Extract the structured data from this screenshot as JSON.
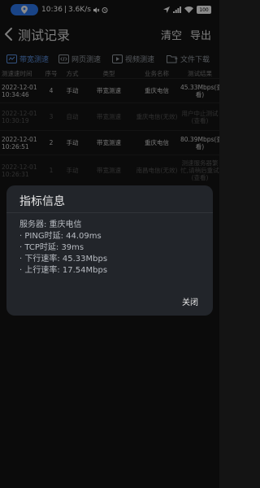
{
  "status_bar": {
    "time": "10:36",
    "speed": "3.6K/s",
    "battery": "100"
  },
  "header": {
    "title": "测试记录",
    "clear_label": "清空",
    "export_label": "导出"
  },
  "tabs": [
    {
      "label": "带宽测速",
      "icon": "speed-test-icon"
    },
    {
      "label": "网页测速",
      "icon": "code-icon"
    },
    {
      "label": "视频测速",
      "icon": "video-icon"
    },
    {
      "label": "文件下载",
      "icon": "folder-download-icon"
    }
  ],
  "table": {
    "columns": [
      "测速速时间",
      "序号",
      "方式",
      "类型",
      "业务名称",
      "测试结果"
    ],
    "rows": [
      {
        "date": "2022-12-01",
        "time": "10:34:46",
        "seq": "4",
        "mode": "手动",
        "type": "带宽测速",
        "server": "重庆电信",
        "result": "45.33Mbps(查看)"
      },
      {
        "date": "2022-12-01",
        "time": "10:30:19",
        "seq": "3",
        "mode": "自动",
        "type": "带宽测速",
        "server": "重庆电信(无效)",
        "result": "用户中止测试(查看)"
      },
      {
        "date": "2022-12-01",
        "time": "10:26:51",
        "seq": "2",
        "mode": "手动",
        "type": "带宽测速",
        "server": "重庆电信",
        "result": "80.39Mbps(查看)"
      },
      {
        "date": "2022-12-01",
        "time": "10:26:31",
        "seq": "1",
        "mode": "手动",
        "type": "带宽测速",
        "server": "南昌电信(无效)",
        "result": "测速服务器繁忙,请稍后重试(查看)"
      }
    ]
  },
  "dialog": {
    "title": "指标信息",
    "server_line": "服务器: 重庆电信",
    "ping_line": "· PING时延: 44.09ms",
    "tcp_line": "· TCP时延: 39ms",
    "down_line": "· 下行速率: 45.33Mbps",
    "up_line": "· 上行速率: 17.54Mbps",
    "close_label": "关闭"
  },
  "colors": {
    "background": "#141414",
    "accent": "#2f7cf6",
    "dialog": "#22252a"
  }
}
